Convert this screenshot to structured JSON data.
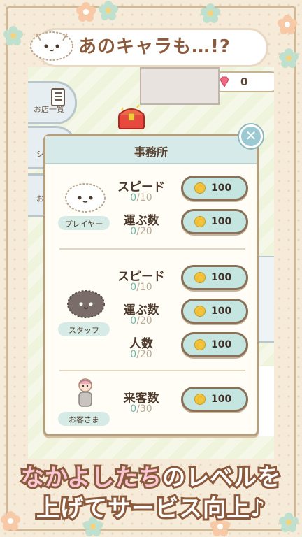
{
  "headline": {
    "text": "あのキャラも…!?"
  },
  "hud": {
    "gem_count": "0"
  },
  "side_menu": {
    "shop_list_label": "お店一覧",
    "item2_label": "シ",
    "item3_label": "お"
  },
  "dialog": {
    "title": "事務所",
    "close_icon": "close-icon",
    "sections": [
      {
        "role": "プレイヤー",
        "stats": [
          {
            "name": "スピード",
            "current": "0",
            "max": "/10",
            "cost": "100"
          },
          {
            "name": "運ぶ数",
            "current": "0",
            "max": "/20",
            "cost": "100"
          }
        ]
      },
      {
        "role": "スタッフ",
        "stats": [
          {
            "name": "スピード",
            "current": "0",
            "max": "/10",
            "cost": "100"
          },
          {
            "name": "運ぶ数",
            "current": "0",
            "max": "/20",
            "cost": "100"
          },
          {
            "name": "人数",
            "current": "0",
            "max": "/20",
            "cost": "100"
          }
        ]
      },
      {
        "role": "お客さま",
        "stats": [
          {
            "name": "来客数",
            "current": "0",
            "max": "/30",
            "cost": "100"
          }
        ]
      }
    ]
  },
  "caption": {
    "line1_accent": "なかよしたち",
    "line1_rest": "のレベルを",
    "line2": "上げてサービス向上♪"
  },
  "colors": {
    "accent_teal": "#c5e5e1",
    "border_brown": "#8a7057",
    "level_current": "#6cb9a7",
    "coin": "#f2c53c"
  }
}
